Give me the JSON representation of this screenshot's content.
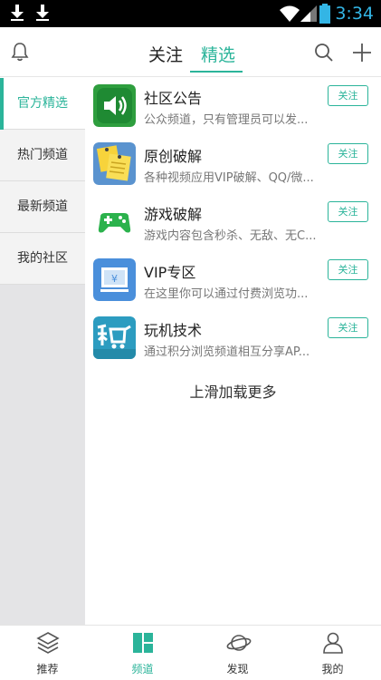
{
  "status_bar": {
    "time": "3:34"
  },
  "header": {
    "tabs": [
      {
        "label": "关注"
      },
      {
        "label": "精选"
      }
    ]
  },
  "sidebar": {
    "items": [
      {
        "label": "官方精选"
      },
      {
        "label": "热门频道"
      },
      {
        "label": "最新频道"
      },
      {
        "label": "我的社区"
      }
    ]
  },
  "channels": [
    {
      "title": "社区公告",
      "desc": "公众频道，只有管理员可以发...",
      "follow_label": "关注",
      "icon": "speaker-icon"
    },
    {
      "title": "原创破解",
      "desc": "各种视频应用VIP破解、QQ/微...",
      "follow_label": "关注",
      "icon": "notes-icon"
    },
    {
      "title": "游戏破解",
      "desc": "游戏内容包含秒杀、无敌、无C...",
      "follow_label": "关注",
      "icon": "gamepad-icon"
    },
    {
      "title": "VIP专区",
      "desc": "在这里你可以通过付费浏览功...",
      "follow_label": "关注",
      "icon": "vip-screen-icon"
    },
    {
      "title": "玩机技术",
      "desc": "通过积分浏览频道相互分享AP...",
      "follow_label": "关注",
      "icon": "points-cart-icon"
    }
  ],
  "load_more": "上滑加载更多",
  "bottom_nav": {
    "items": [
      {
        "label": "推荐",
        "icon": "layers-icon"
      },
      {
        "label": "频道",
        "icon": "channel-icon"
      },
      {
        "label": "发现",
        "icon": "planet-icon"
      },
      {
        "label": "我的",
        "icon": "person-icon"
      }
    ]
  },
  "colors": {
    "accent": "#2bb49a"
  }
}
